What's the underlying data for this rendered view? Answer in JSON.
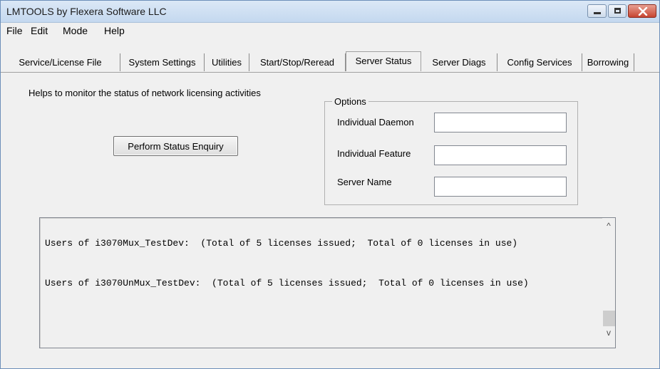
{
  "window": {
    "title": "LMTOOLS by Flexera Software LLC",
    "controls": {
      "minimize_icon": "minimize-icon",
      "maximize_icon": "maximize-icon",
      "close_icon": "close-icon",
      "close_color": "#c74531"
    }
  },
  "menu": {
    "file": "File",
    "edit": "Edit",
    "mode": "Mode",
    "help": "Help"
  },
  "tabs": [
    {
      "label": "Service/License File",
      "active": false
    },
    {
      "label": "System Settings",
      "active": false
    },
    {
      "label": "Utilities",
      "active": false
    },
    {
      "label": "Start/Stop/Reread",
      "active": false
    },
    {
      "label": "Server Status",
      "active": true
    },
    {
      "label": "Server Diags",
      "active": false
    },
    {
      "label": "Config Services",
      "active": false
    },
    {
      "label": "Borrowing",
      "active": false
    }
  ],
  "server_status": {
    "description": "Helps to monitor the status of network licensing activities",
    "perform_button": "Perform Status Enquiry",
    "options": {
      "legend": "Options",
      "individual_daemon_label": "Individual Daemon",
      "individual_daemon_value": "",
      "individual_feature_label": "Individual Feature",
      "individual_feature_value": "",
      "server_name_label": "Server Name",
      "server_name_value": ""
    },
    "output": {
      "line1": "Users of i3070Mux_TestDev:  (Total of 5 licenses issued;  Total of 0 licenses in use)",
      "line2": "Users of i3070UnMux_TestDev:  (Total of 5 licenses issued;  Total of 0 licenses in use)"
    }
  },
  "scrollbar": {
    "up_glyph": "^",
    "down_glyph": "v"
  }
}
